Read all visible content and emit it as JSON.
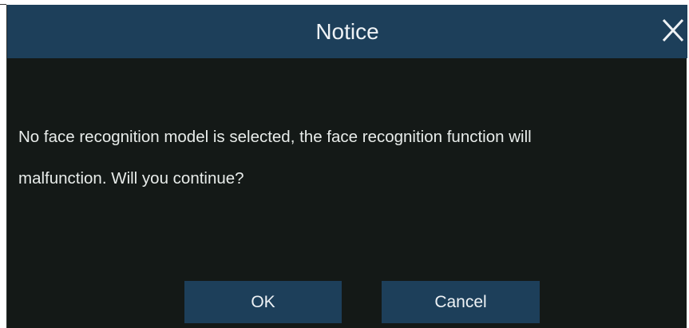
{
  "dialog": {
    "title": "Notice",
    "close_icon": "close-icon",
    "message_line_1": "No face recognition model is selected, the face recognition function will",
    "message_line_2": "malfunction. Will you continue?",
    "ok_label": "OK",
    "cancel_label": "Cancel"
  },
  "colors": {
    "titlebar": "#1d3f5a",
    "body": "#141917",
    "button": "#1d3f5a",
    "text": "#eef2f5"
  }
}
